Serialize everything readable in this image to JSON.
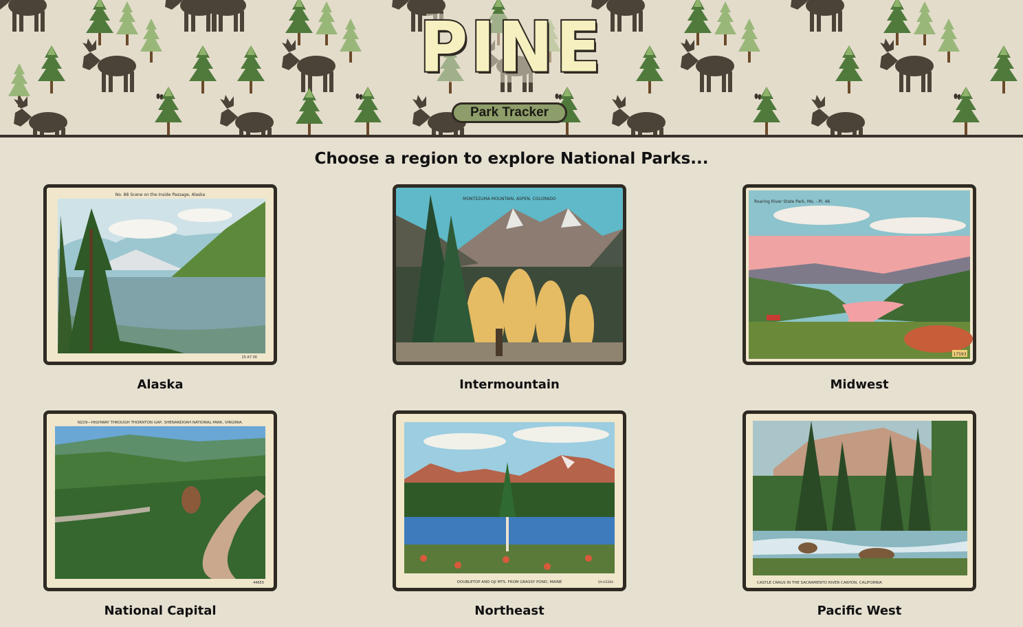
{
  "header": {
    "logo_text": "PINE",
    "tracker_label": "Park Tracker"
  },
  "main": {
    "heading": "Choose a region to explore National Parks..."
  },
  "regions": [
    {
      "label": "Alaska",
      "caption": "No. 88 Scene on the Inside Passage, Alaska",
      "stamp": "15 A7 00"
    },
    {
      "label": "Intermountain",
      "caption": "MONTEZUMA MOUNTAIN, ASPEN, COLORADO",
      "stamp": ""
    },
    {
      "label": "Midwest",
      "caption": "Roaring River State Park, Mo. - Pl. 46",
      "stamp": "17593"
    },
    {
      "label": "National Capital",
      "caption": "N229—HIGHWAY THROUGH THORNTON GAP, SHENANDOAH NATIONAL PARK, VIRGINIA.",
      "stamp": "44655"
    },
    {
      "label": "Northeast",
      "caption": "DOUBLETOP AND OJI MTS. FROM GRASSY POND, MAINE",
      "stamp": "5A-H2284"
    },
    {
      "label": "Pacific West",
      "caption": "CASTLE CRAGS IN THE SACRAMENTO RIVER CANYON, CALIFORNIA",
      "stamp": ""
    }
  ],
  "colors": {
    "background": "#e6e0d1",
    "frame": "#2f2a22",
    "button": "#8e9e6a",
    "logo_fill": "#f6f0c0"
  },
  "icons": [
    "moose-icon",
    "pine-tree-icon",
    "hoof-print-icon"
  ]
}
